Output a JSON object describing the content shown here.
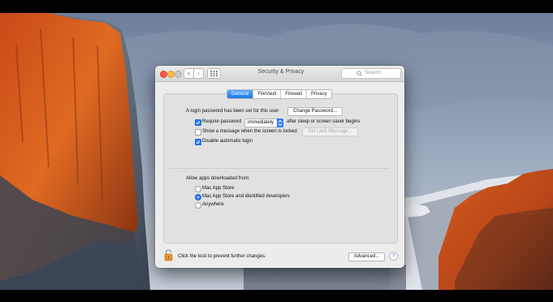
{
  "window": {
    "title": "Security & Privacy",
    "search_placeholder": "Search",
    "nav_back_glyph": "‹",
    "nav_forward_glyph": "›"
  },
  "tabs": [
    {
      "label": "General",
      "active": true
    },
    {
      "label": "FileVault",
      "active": false
    },
    {
      "label": "Firewall",
      "active": false
    },
    {
      "label": "Privacy",
      "active": false
    }
  ],
  "general": {
    "login_password_text": "A login password has been set for this user",
    "change_password_label": "Change Password...",
    "require_password": {
      "label": "Require password",
      "checked": true,
      "value": "immediately",
      "suffix": "after sleep or screen saver begins"
    },
    "show_message": {
      "label": "Show a message when the screen is locked",
      "checked": false,
      "button_label": "Set Lock Message..."
    },
    "disable_autologin": {
      "label": "Disable automatic login",
      "checked": true
    }
  },
  "gatekeeper": {
    "heading": "Allow apps downloaded from:",
    "options": [
      {
        "label": "Mac App Store",
        "selected": false
      },
      {
        "label": "Mac App Store and identified developers",
        "selected": true
      },
      {
        "label": "Anywhere",
        "selected": false
      }
    ]
  },
  "footer": {
    "lock_text": "Click the lock to prevent further changes.",
    "advanced_label": "Advanced...",
    "help_label": "?"
  },
  "colors": {
    "accent": "#2f7df6",
    "close": "#fc5753",
    "minimize": "#fdbc40",
    "lock": "#e2962d"
  },
  "icons": [
    "close-icon",
    "minimize-icon",
    "zoom-icon",
    "chevron-left-icon",
    "chevron-right-icon",
    "grid-icon",
    "search-icon",
    "checkmark-icon",
    "lock-icon",
    "help-icon"
  ]
}
